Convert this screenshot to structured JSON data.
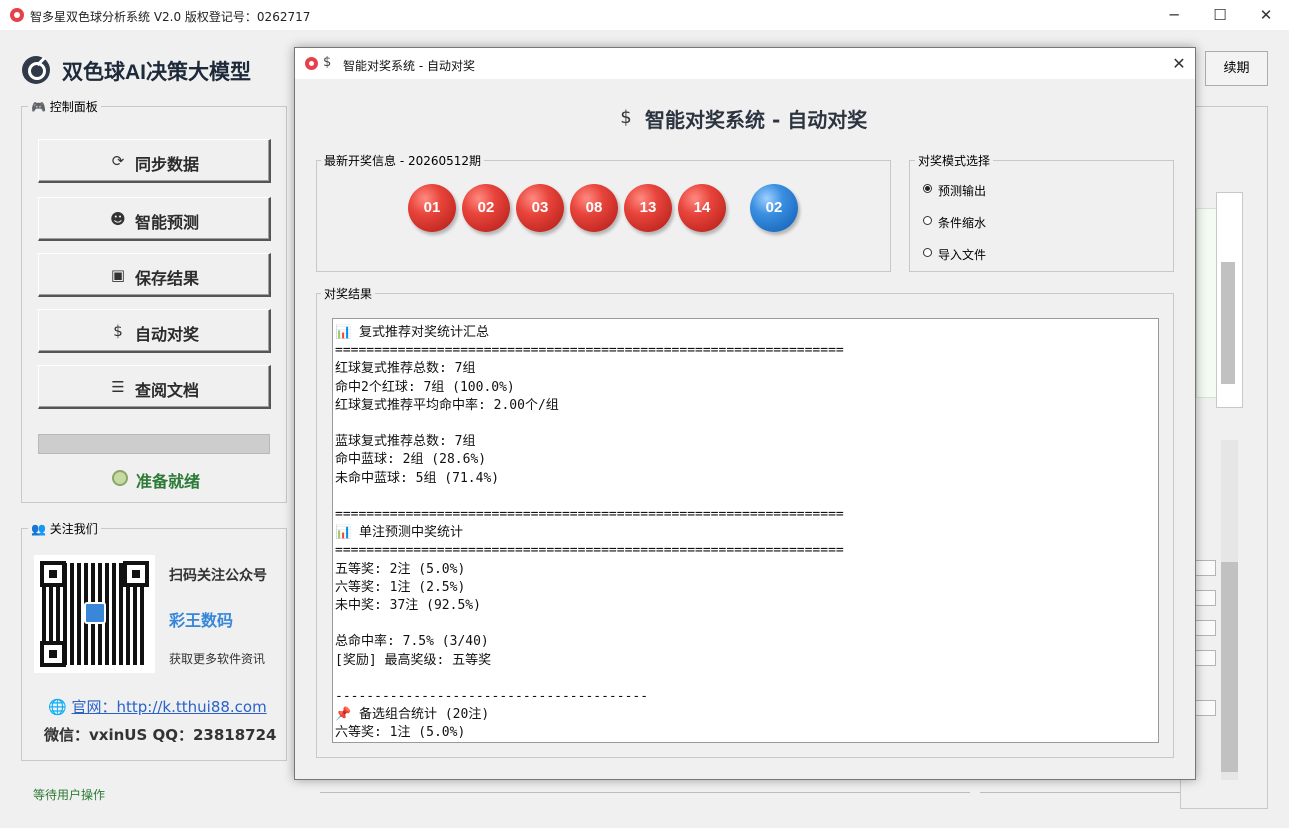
{
  "window": {
    "title": "智多星双色球分析系统 V2.0    版权登记号：0262717",
    "minimize_glyph": "─",
    "maximize_glyph": "☐",
    "close_glyph": "✕"
  },
  "brand": {
    "title": "双色球AI决策大模型",
    "icon": "target-logo-icon"
  },
  "renew_label": "续期",
  "control_panel": {
    "legend": "控制面板",
    "legend_icon": "gamepad-icon",
    "buttons": [
      {
        "label": "同步数据",
        "icon": "sync-icon",
        "glyph": "⟳"
      },
      {
        "label": "智能预测",
        "icon": "robot-icon",
        "glyph": "☻"
      },
      {
        "label": "保存结果",
        "icon": "save-icon",
        "glyph": "▣"
      },
      {
        "label": "自动对奖",
        "icon": "money-bag-icon",
        "glyph": "$"
      },
      {
        "label": "查阅文档",
        "icon": "document-icon",
        "glyph": "☰"
      }
    ],
    "progress": 0,
    "status": "准备就绪"
  },
  "follow": {
    "legend": "关注我们",
    "legend_icon": "people-icon",
    "scan_text": "扫码关注公众号",
    "account_name": "彩王数码",
    "more_text": "获取更多软件资讯",
    "website": "官网：http://k.tthui88.com",
    "contact": "微信：vxinUS   QQ：23818724"
  },
  "bottom_status": "等待用户操作",
  "dialog": {
    "title": "智能对奖系统 - 自动对奖",
    "heading": "智能对奖系统 - 自动对奖",
    "close_glyph": "✕",
    "draw_info": {
      "legend": "最新开奖信息 - 20260512期",
      "red_balls": [
        "01",
        "02",
        "03",
        "08",
        "13",
        "14"
      ],
      "blue_balls": [
        "02"
      ]
    },
    "mode": {
      "legend": "对奖模式选择",
      "options": [
        {
          "label": "预测输出",
          "checked": true
        },
        {
          "label": "条件缩水",
          "checked": false
        },
        {
          "label": "导入文件",
          "checked": false
        }
      ]
    },
    "results": {
      "legend": "对奖结果",
      "lines": [
        "📊 复式推荐对奖统计汇总",
        "=================================================================",
        "红球复式推荐总数: 7组",
        "命中2个红球: 7组 (100.0%)",
        "红球复式推荐平均命中率: 2.00个/组",
        "",
        "蓝球复式推荐总数: 7组",
        "命中蓝球: 2组 (28.6%)",
        "未命中蓝球: 5组 (71.4%)",
        "",
        "=================================================================",
        "📊 单注预测中奖统计",
        "=================================================================",
        "五等奖: 2注 (5.0%)",
        "六等奖: 1注 (2.5%)",
        "未中奖: 37注 (92.5%)",
        "",
        "总命中率: 7.5% (3/40)",
        "[奖励] 最高奖级: 五等奖",
        "",
        "----------------------------------------",
        "📌 备选组合统计 (20注)",
        "六等奖: 1注 (5.0%)"
      ]
    },
    "scroll_up": "▲",
    "scroll_down": "▼"
  },
  "colors": {
    "accent_green": "#2c7a35",
    "link_blue": "#2a62c9",
    "red_ball": "#d8372f",
    "blue_ball": "#2a7fd4"
  }
}
